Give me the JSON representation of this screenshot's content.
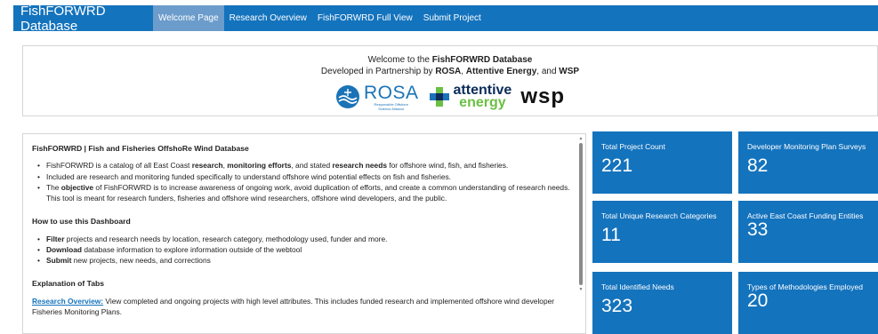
{
  "app": {
    "brand": "FishFORWRD Database",
    "nav": [
      {
        "label": "Welcome Page",
        "active": true
      },
      {
        "label": "Research Overview",
        "active": false
      },
      {
        "label": "FishFORWRD Full View",
        "active": false
      },
      {
        "label": "Submit Project",
        "active": false
      }
    ],
    "accent_color": "#1473bd"
  },
  "welcome": {
    "line1_prefix": "Welcome to the ",
    "line1_bold": "FishFORWRD Database",
    "line2_prefix": "Developed in Partnership by ",
    "partner1": "ROSA",
    "sep1": ", ",
    "partner2": "Attentive Energy",
    "sep2": ", and ",
    "partner3": "WSP",
    "logos": {
      "rosa": "ROSA",
      "rosa_sub1": "Responsible Offshore",
      "rosa_sub2": "Science Alliance",
      "attentive1": "attentive",
      "attentive2": "energy",
      "wsp": "wsp"
    }
  },
  "info": {
    "title": "FishFORWRD | Fish and Fisheries OffshoRe Wind Database",
    "bullet1": {
      "t1": "FishFORWRD is a catalog of all East Coast ",
      "b1": "research",
      "t2": ", ",
      "b2": "monitoring efforts",
      "t3": ", and stated ",
      "b3": "research needs",
      "t4": " for offshore wind, fish, and fisheries."
    },
    "bullet2": "Included are research and monitoring funded specifically to understand offshore wind potential effects on fish and fisheries.",
    "bullet3": {
      "t1": "The ",
      "b1": "objective",
      "t2": " of FishFORWRD is to increase awareness of ongoing work, avoid duplication of efforts, and create a common understanding of research needs. This tool is meant for research funders, fisheries and offshore wind researchers, offshore wind developers, and the public."
    },
    "howto_title": "How to use this Dashboard",
    "howto1": {
      "b": "Filter",
      "t": " projects and research needs by location, research category, methodology used, funder and more."
    },
    "howto2": {
      "b": "Download",
      "t": " database information to explore information outside of the webtool"
    },
    "howto3": {
      "b": "Submit",
      "t": " new projects, new needs, and corrections"
    },
    "tabs_title": "Explanation of Tabs",
    "tabs_link": "Research Overview:",
    "tabs_text": " View completed and ongoing projects with high level attributes. This includes funded research and implemented offshore wind developer Fisheries Monitoring Plans."
  },
  "stats": [
    {
      "label": "Total Project Count",
      "value": "221"
    },
    {
      "label": "Developer Monitoring Plan Surveys",
      "value": "82"
    },
    {
      "label": "Total Unique Research Categories",
      "value": "11"
    },
    {
      "label": "Active East Coast Funding Entities",
      "value": "33"
    },
    {
      "label": "Total Identified Needs",
      "value": "323"
    },
    {
      "label": "Types of Methodologies Employed",
      "value": "20"
    }
  ]
}
